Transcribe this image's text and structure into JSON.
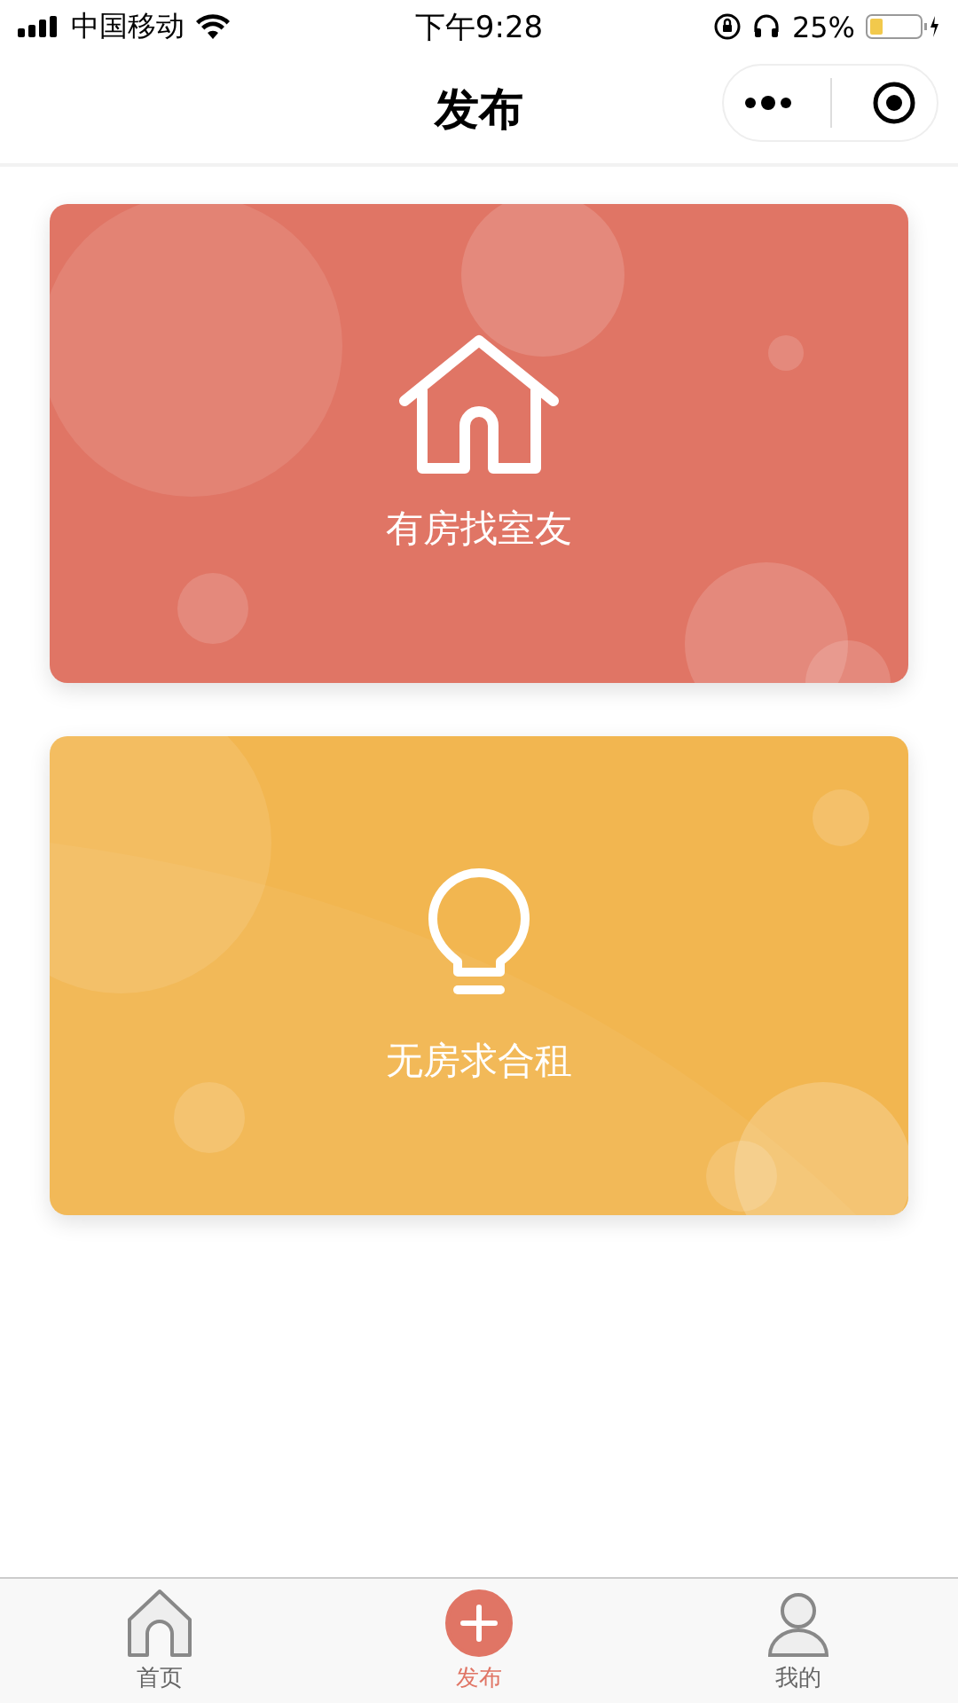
{
  "status_bar": {
    "carrier": "中国移动",
    "time": "下午9:28",
    "battery": "25%"
  },
  "nav": {
    "title": "发布"
  },
  "cards": [
    {
      "kind": "house",
      "label": "有房找室友",
      "color": "#e07565"
    },
    {
      "kind": "bulb",
      "label": "无房求合租",
      "color": "#f2b650"
    }
  ],
  "tab_bar": [
    {
      "kind": "home",
      "label": "首页",
      "selected": false
    },
    {
      "kind": "publish",
      "label": "发布",
      "selected": true
    },
    {
      "kind": "profile",
      "label": "我的",
      "selected": false
    }
  ]
}
